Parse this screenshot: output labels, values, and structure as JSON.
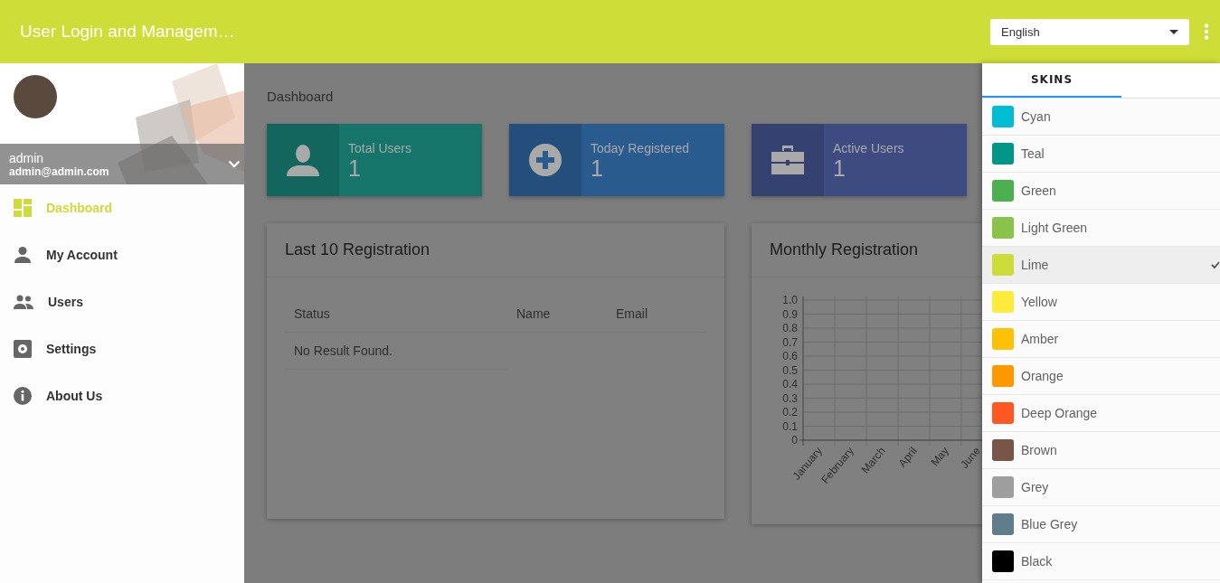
{
  "header": {
    "title": "User Login and Managem…",
    "language": "English"
  },
  "profile": {
    "name": "admin",
    "email": "admin@admin.com"
  },
  "sidebar": {
    "items": [
      {
        "label": "Dashboard",
        "kind": "dashboard",
        "selected": true
      },
      {
        "label": "My Account",
        "kind": "account",
        "selected": false
      },
      {
        "label": "Users",
        "kind": "users",
        "selected": false
      },
      {
        "label": "Settings",
        "kind": "settings",
        "selected": false
      },
      {
        "label": "About Us",
        "kind": "about",
        "selected": false
      }
    ]
  },
  "breadcrumb": "Dashboard",
  "stat_boxes": [
    {
      "label": "Total Users",
      "value": "1",
      "kind": "person",
      "color": "#15756b"
    },
    {
      "label": "Today Registered",
      "value": "1",
      "kind": "plus",
      "color": "#2a5b8e"
    },
    {
      "label": "Active Users",
      "value": "1",
      "kind": "briefcase",
      "color": "#3d4b80"
    }
  ],
  "registrations": {
    "title": "Last 10 Registration",
    "columns": [
      "Status",
      "Name",
      "Email"
    ],
    "empty_message": "No Result Found."
  },
  "monthly": {
    "title": "Monthly Registration",
    "chart_data": {
      "type": "bar",
      "categories": [
        "January",
        "February",
        "March",
        "April",
        "May",
        "June"
      ],
      "values": [
        null,
        null,
        null,
        null,
        null,
        null
      ],
      "grid": true,
      "ylim": [
        0,
        1
      ],
      "yticks": [
        0,
        {
          "value": 0.1,
          "label": "0.1"
        },
        {
          "value": 0.2,
          "label": "0.2"
        },
        {
          "value": 0.3,
          "label": "0.3"
        },
        {
          "value": 0.4,
          "label": "0.4"
        },
        {
          "value": 0.5,
          "label": "0.5"
        },
        {
          "value": 0.6,
          "label": "0.6"
        },
        {
          "value": 0.7,
          "label": "0.7"
        },
        {
          "value": 0.8,
          "label": "0.8"
        },
        {
          "value": 0.9,
          "label": "0.9"
        },
        {
          "value": 1,
          "label": "1.0"
        }
      ]
    }
  },
  "skins_panel": {
    "tabs": [
      {
        "label": "SKINS",
        "selected": true
      }
    ],
    "skins": [
      {
        "label": "Cyan",
        "color": "#00bcd4",
        "selected": false
      },
      {
        "label": "Teal",
        "color": "#009688",
        "selected": false
      },
      {
        "label": "Green",
        "color": "#4caf50",
        "selected": false
      },
      {
        "label": "Light Green",
        "color": "#8bc34a",
        "selected": false
      },
      {
        "label": "Lime",
        "color": "#cddc39",
        "selected": true
      },
      {
        "label": "Yellow",
        "color": "#ffeb3b",
        "selected": false
      },
      {
        "label": "Amber",
        "color": "#ffc107",
        "selected": false
      },
      {
        "label": "Orange",
        "color": "#ff9800",
        "selected": false
      },
      {
        "label": "Deep Orange",
        "color": "#ff5722",
        "selected": false
      },
      {
        "label": "Brown",
        "color": "#795548",
        "selected": false
      },
      {
        "label": "Grey",
        "color": "#9e9e9e",
        "selected": false
      },
      {
        "label": "Blue Grey",
        "color": "#607d8b",
        "selected": false
      },
      {
        "label": "Black",
        "color": "#000000",
        "selected": false
      }
    ]
  }
}
